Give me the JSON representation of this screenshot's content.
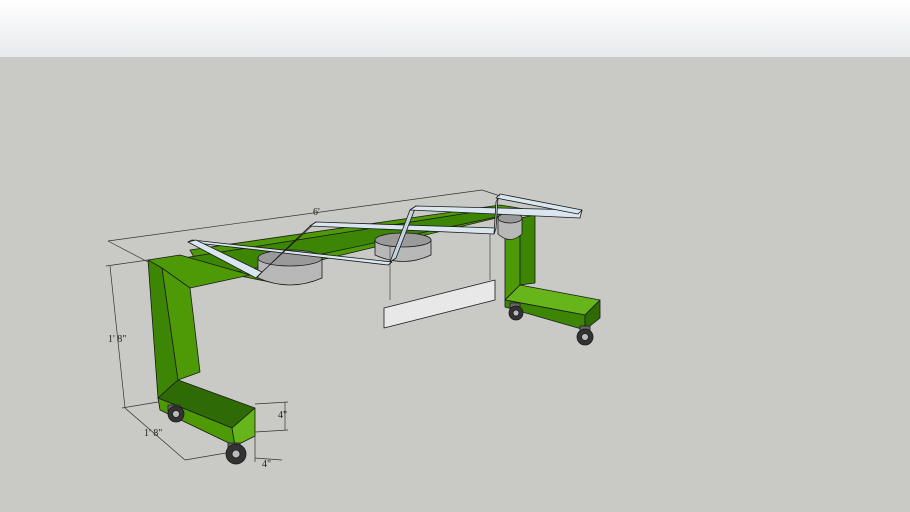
{
  "colors": {
    "sky_top": "#ffffff",
    "sky_bottom": "#e7e9ec",
    "ground": "#c9c9c5",
    "frame_green": "#4e9a06",
    "frame_green_dark": "#2f6b04",
    "frame_green_top": "#66b51a",
    "rail_blue": "#d9e6ef",
    "bowl_gray": "#b5b5b5",
    "panel_gray": "#e8e8e8",
    "edge": "#1a1a1a"
  },
  "dimensions": {
    "length": "6'",
    "height": "1' 8\"",
    "depth": "1' 8\"",
    "base_height": "4\"",
    "base_width": "4\""
  }
}
